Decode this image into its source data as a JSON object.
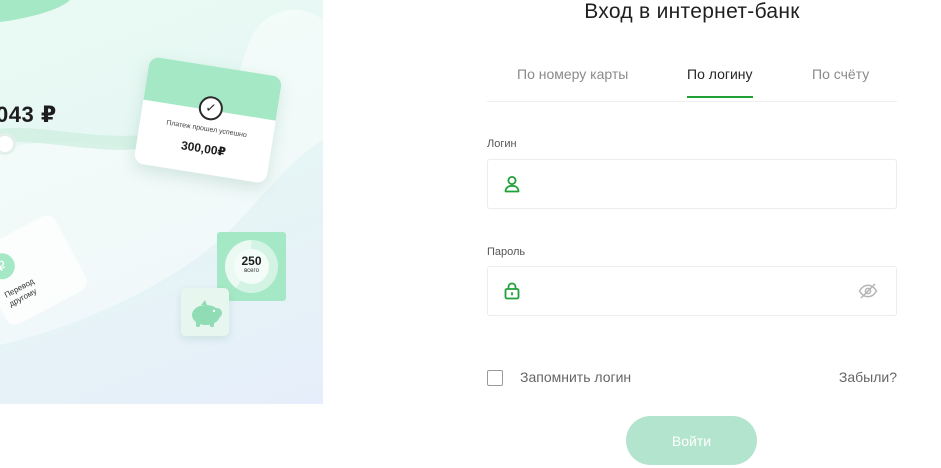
{
  "promo": {
    "balance": "043 ₽",
    "payment_card": {
      "message": "Платеж прошел успешно",
      "amount": "300,00₽",
      "icon": "check-icon"
    },
    "transfer_card": {
      "label_line1": "Перевод",
      "label_line2": "другому",
      "icon": "ruble-icon"
    },
    "stat": {
      "number": "250",
      "caption": "всего",
      "icon": "donut-chart"
    },
    "piggy": {
      "icon": "piggy-bank-icon"
    }
  },
  "login": {
    "title": "Вход в интернет-банк",
    "tabs": [
      {
        "label": "По номеру карты",
        "active": false
      },
      {
        "label": "По логину",
        "active": true
      },
      {
        "label": "По счёту",
        "active": false
      }
    ],
    "login_field": {
      "label": "Логин",
      "value": "",
      "placeholder": "",
      "icon": "user-icon"
    },
    "password_field": {
      "label": "Пароль",
      "value": "",
      "placeholder": "",
      "icon": "lock-icon",
      "toggle_icon": "eye-off-icon"
    },
    "remember_label": "Запомнить логин",
    "remember_checked": false,
    "forgot_label": "Забыли?",
    "submit_label": "Войти"
  },
  "colors": {
    "accent": "#21a038",
    "button_disabled": "#b3e4cd",
    "promo_mint": "#a5e8c6"
  }
}
